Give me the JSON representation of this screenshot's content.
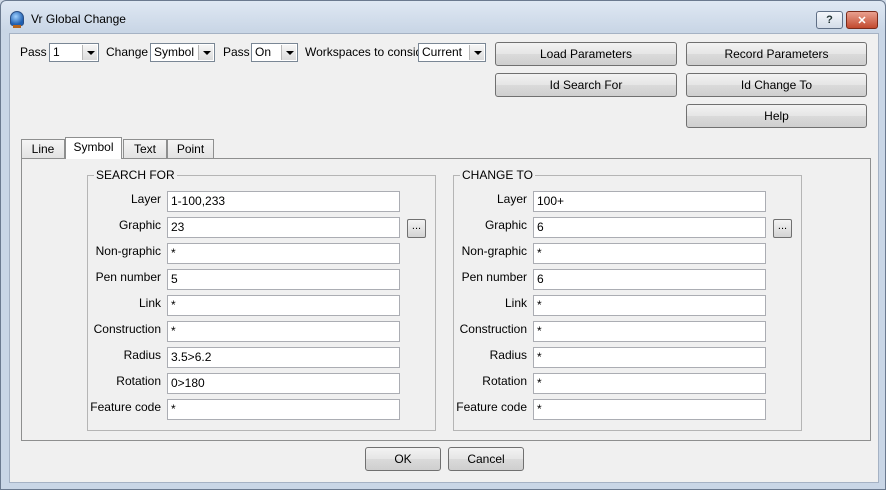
{
  "window": {
    "title": "Vr Global Change",
    "help_glyph": "?",
    "close_glyph": "✕"
  },
  "toolbar": {
    "pass_label": "Pass",
    "pass_value": "1",
    "change_label": "Change",
    "change_value": "Symbol",
    "pass2_label": "Pass",
    "pass2_value": "On",
    "workspaces_label": "Workspaces to consid",
    "workspaces_value": "Current"
  },
  "buttons": {
    "load_parameters": "Load Parameters",
    "record_parameters": "Record Parameters",
    "id_search_for": "Id Search For",
    "id_change_to": "Id Change To",
    "help": "Help",
    "ok": "OK",
    "cancel": "Cancel"
  },
  "tabs": [
    {
      "label": "Line"
    },
    {
      "label": "Symbol"
    },
    {
      "label": "Text"
    },
    {
      "label": "Point"
    }
  ],
  "search_for": {
    "title": "SEARCH FOR",
    "browse_label": "...",
    "rows": [
      {
        "label": "Layer",
        "value": "1-100,233"
      },
      {
        "label": "Graphic",
        "value": "23"
      },
      {
        "label": "Non-graphic",
        "value": "*"
      },
      {
        "label": "Pen number",
        "value": "5"
      },
      {
        "label": "Link",
        "value": "*"
      },
      {
        "label": "Construction",
        "value": "*"
      },
      {
        "label": "Radius",
        "value": "3.5>6.2"
      },
      {
        "label": "Rotation",
        "value": "0>180"
      },
      {
        "label": "Feature code",
        "value": "*"
      }
    ]
  },
  "change_to": {
    "title": "CHANGE TO",
    "browse_label": "...",
    "rows": [
      {
        "label": "Layer",
        "value": "100+"
      },
      {
        "label": "Graphic",
        "value": "6"
      },
      {
        "label": "Non-graphic",
        "value": "*"
      },
      {
        "label": "Pen number",
        "value": "6"
      },
      {
        "label": "Link",
        "value": "*"
      },
      {
        "label": "Construction",
        "value": "*"
      },
      {
        "label": "Radius",
        "value": "*"
      },
      {
        "label": "Rotation",
        "value": "*"
      },
      {
        "label": "Feature code",
        "value": "*"
      }
    ]
  }
}
